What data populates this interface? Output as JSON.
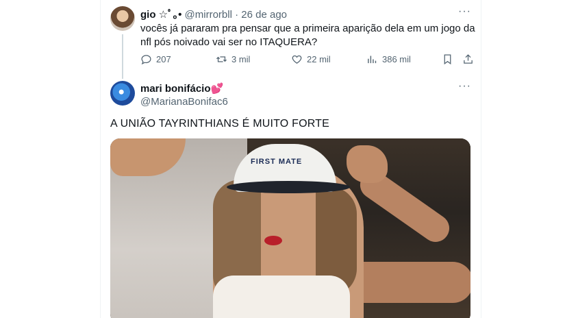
{
  "tweet1": {
    "name": "gio",
    "name_decoration": "☆ﾟ｡•",
    "handle": "@mirrorbll",
    "separator": "·",
    "date": "26 de ago",
    "more": "···",
    "text": "vocês já pararam pra pensar que a primeira aparição dela em um jogo da nfl pós noivado vai ser no ITAQUERA?",
    "actions": {
      "replies": "207",
      "retweets": "3 mil",
      "likes": "22 mil",
      "views": "386 mil"
    }
  },
  "tweet2": {
    "name": "mari bonifácio",
    "name_emoji": "💕",
    "handle": "@MarianaBonifac6",
    "more": "···",
    "text": "A UNIÃO TAYRINTHIANS É MUITO FORTE",
    "photo": {
      "cap_text": "FIRST MATE"
    }
  }
}
